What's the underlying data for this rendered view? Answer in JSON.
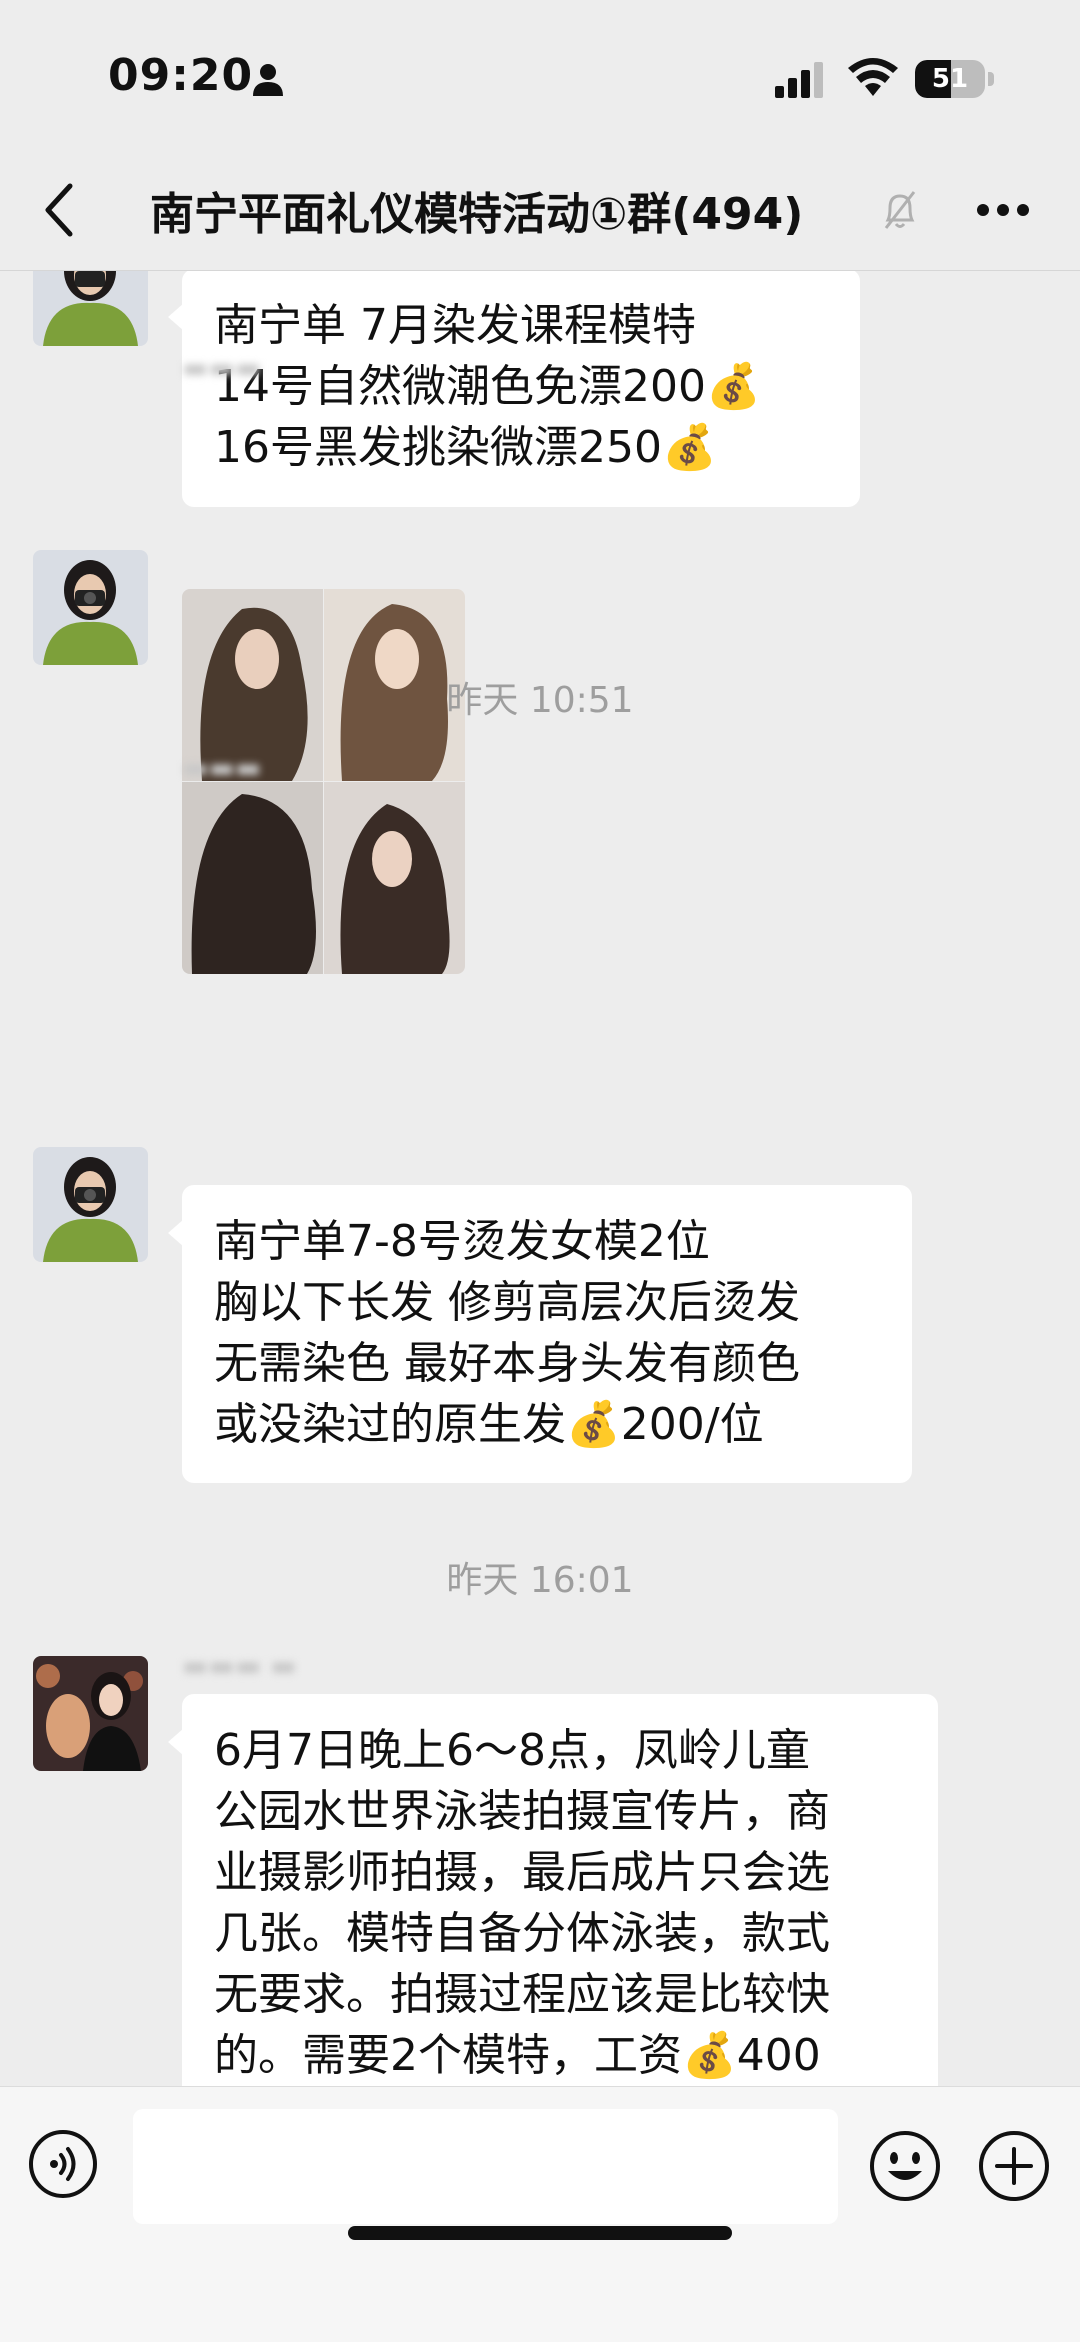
{
  "status_bar": {
    "time": "09:20",
    "battery": "51",
    "battery_level": 0.51,
    "icons": [
      "person-icon",
      "signal-icon",
      "wifi-icon",
      "battery-icon"
    ]
  },
  "nav": {
    "title": "南宁平面礼仪模特活动①群(494)",
    "back_icon": "chevron-left-icon",
    "mute_icon": "bell-slash-icon",
    "more_icon": "ellipsis-icon"
  },
  "messages": [
    {
      "type": "text",
      "text": "南宁单 7月染发课程模特\n14号自然微潮色免漂200💰\n16号黑发挑染微漂250💰"
    },
    {
      "type": "image"
    },
    {
      "type": "timestamp",
      "text": "昨天 10:51"
    },
    {
      "type": "text",
      "text": "南宁单7-8号烫发女模2位\n胸以下长发 修剪高层次后烫发\n无需染色 最好本身头发有颜色\n或没染过的原生发💰200/位"
    },
    {
      "type": "timestamp",
      "text": "昨天 16:01"
    },
    {
      "type": "text",
      "text": "6月7日晚上6～8点，凤岭儿童\n公园水世界泳装拍摄宣传片，商\n业摄影师拍摄，最后成片只会选\n几张。模特自备分体泳装，款式\n无要求。拍摄过程应该是比较快\n的。需要2个模特，工资💰400"
    }
  ],
  "input_bar": {
    "voice_icon": "voice-icon",
    "emoji_icon": "smile-icon",
    "plus_icon": "plus-circle-icon",
    "placeholder": ""
  },
  "colors": {
    "background": "#ededed",
    "bubble": "#ffffff",
    "timestamp": "#9e9e9e"
  }
}
